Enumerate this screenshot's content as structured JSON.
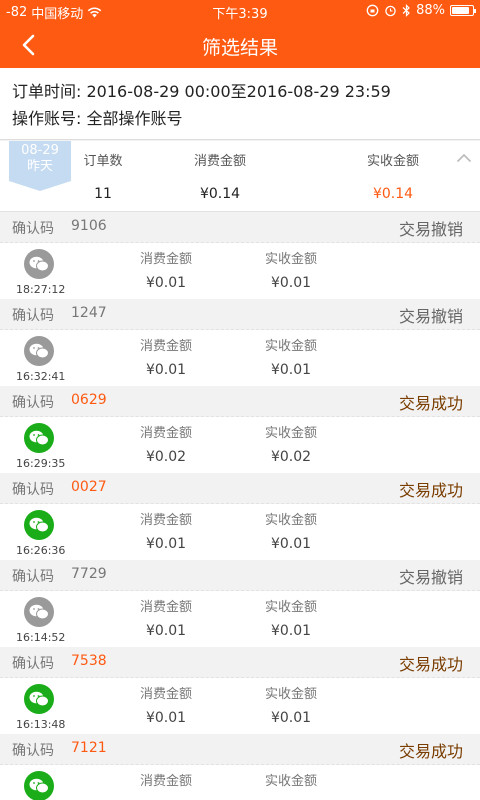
{
  "statusbar": {
    "signal": "-82",
    "carrier": "中国移动",
    "time": "下午3:39",
    "battery": "88%",
    "battery_level": 0.88
  },
  "nav": {
    "title": "筛选结果"
  },
  "filter": {
    "order_time": "订单时间: 2016-08-29 00:00至2016-08-29 23:59",
    "operator": "操作账号: 全部操作账号"
  },
  "summary": {
    "date": "08-29",
    "day": "昨天",
    "count_label": "订单数",
    "count": "11",
    "spend_label": "消费金额",
    "spend": "¥0.14",
    "received_label": "实收金额",
    "received": "¥0.14"
  },
  "labels": {
    "code": "确认码",
    "spend": "消费金额",
    "received": "实收金额"
  },
  "records": [
    {
      "code": "9106",
      "status": "交易撤销",
      "ok": false,
      "time": "18:27:12",
      "spend": "¥0.01",
      "received": "¥0.01"
    },
    {
      "code": "1247",
      "status": "交易撤销",
      "ok": false,
      "time": "16:32:41",
      "spend": "¥0.01",
      "received": "¥0.01"
    },
    {
      "code": "0629",
      "status": "交易成功",
      "ok": true,
      "time": "16:29:35",
      "spend": "¥0.02",
      "received": "¥0.02"
    },
    {
      "code": "0027",
      "status": "交易成功",
      "ok": true,
      "time": "16:26:36",
      "spend": "¥0.01",
      "received": "¥0.01"
    },
    {
      "code": "7729",
      "status": "交易撤销",
      "ok": false,
      "time": "16:14:52",
      "spend": "¥0.01",
      "received": "¥0.01"
    },
    {
      "code": "7538",
      "status": "交易成功",
      "ok": true,
      "time": "16:13:48",
      "spend": "¥0.01",
      "received": "¥0.01"
    },
    {
      "code": "7121",
      "status": "交易成功",
      "ok": true,
      "time": "",
      "spend": "",
      "received": ""
    }
  ],
  "colors": {
    "accent": "#ff5a12",
    "success_text": "#7a3d00",
    "wechat_green": "#1aad19",
    "wechat_grey": "#9a9a9a"
  }
}
